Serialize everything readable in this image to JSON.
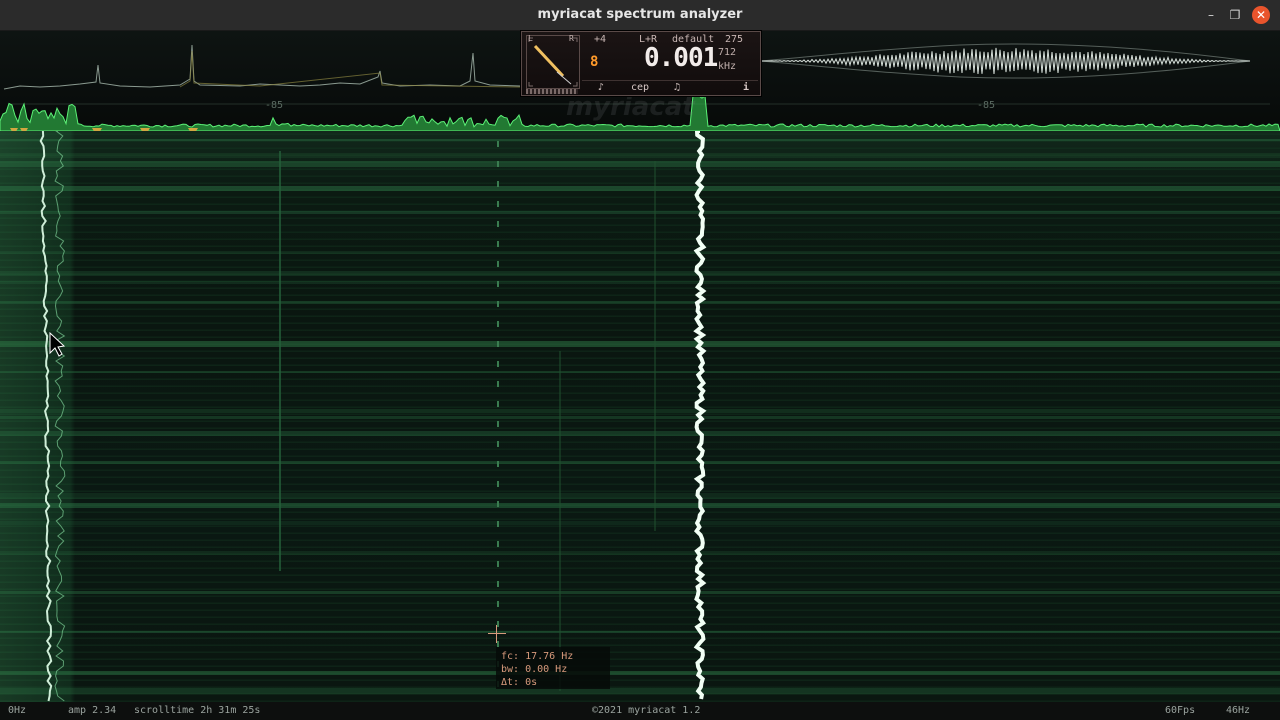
{
  "window": {
    "title": "myriacat spectrum analyzer"
  },
  "hud": {
    "channel": "L+R",
    "preset": "default",
    "preset_number": "275",
    "offset": "+4",
    "frequency_display": "0.001",
    "frequency_sub": "712",
    "frequency_unit": "kHz",
    "orange_readout": "8",
    "gauge_left": "L",
    "gauge_right": "R",
    "tabs": {
      "pitch": "♪",
      "cep": "cep",
      "note": "♫",
      "info": "i"
    }
  },
  "spectrum": {
    "db_marker_left": "-85",
    "db_marker_right": "-85",
    "watermark": "myriacat"
  },
  "cursor_tooltip": {
    "fc": "fc: 17.76 Hz",
    "bw": "bw: 0.00 Hz",
    "dt": "Δt: 0s"
  },
  "status": {
    "freq_min": "0Hz",
    "amp": "amp 2.34",
    "scrolltime": "scrolltime 2h 31m 25s",
    "copyright": "©2021 myriacat 1.2",
    "fps": "60Fps",
    "freq_max": "46Hz"
  },
  "colors": {
    "accent_green": "#3fd35a",
    "trace_white": "#eaffee",
    "hud_orange": "#ff9a2a"
  }
}
